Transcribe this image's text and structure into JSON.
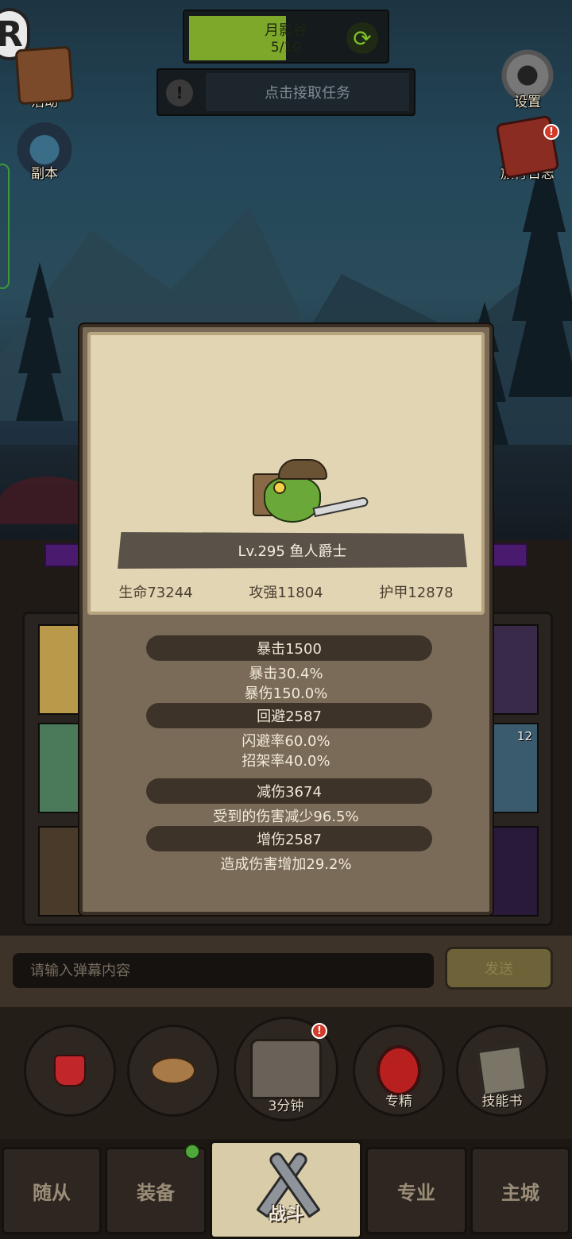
{
  "hud": {
    "logo_letter": "R",
    "zone": {
      "title": "月影谷",
      "progress_text": "5/10",
      "progress": 0.5
    },
    "quest": {
      "label": "点击接取任务"
    },
    "left_buttons": [
      {
        "label": "活动"
      },
      {
        "label": "副本"
      }
    ],
    "right_buttons": [
      {
        "label": "设置"
      },
      {
        "label": "旅行日志"
      }
    ],
    "notification_mark": "!"
  },
  "monster": {
    "name": "Lv.295 鱼人爵士",
    "stats": [
      "生命73244",
      "攻强11804",
      "护甲12878"
    ],
    "details": [
      {
        "header": "暴击1500",
        "lines": [
          "暴击30.4%",
          "暴伤150.0%"
        ]
      },
      {
        "header": "回避2587",
        "lines": [
          "闪避率60.0%",
          "招架率40.0%"
        ]
      },
      {
        "header": "减伤3674",
        "lines": [
          "受到的伤害减少96.5%"
        ]
      },
      {
        "header": "增伤2587",
        "lines": [
          "造成伤害增加29.2%"
        ]
      }
    ]
  },
  "inventory": {
    "badge": "12"
  },
  "chat": {
    "placeholder": "请输入弹幕内容",
    "send_label": "发送"
  },
  "actions": {
    "chest_timer": "3分钟",
    "specialize_label": "专精",
    "skillbook_label": "技能书"
  },
  "nav": {
    "items": [
      "随从",
      "装备",
      "战斗",
      "专业",
      "主城"
    ]
  },
  "colors": {
    "progress_green": "#7ea82a",
    "alert_red": "#d23a2a",
    "parchment": "#e2d5b3"
  }
}
